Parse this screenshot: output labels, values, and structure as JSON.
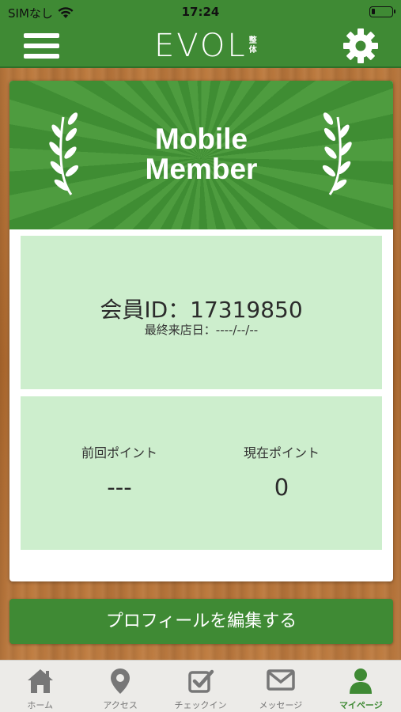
{
  "status_bar": {
    "carrier": "SIMなし",
    "time": "17:24"
  },
  "nav": {
    "logo_text": "EVOL",
    "logo_sub_1": "整",
    "logo_sub_2": "体",
    "menu_icon": "hamburger-menu-icon",
    "settings_icon": "gear-icon"
  },
  "card": {
    "title_line1": "Mobile",
    "title_line2": "Member",
    "member_id": "会員ID：17319850",
    "last_visit": "最終来店日：----/--/--",
    "previous_points_label": "前回ポイント",
    "previous_points_value": "---",
    "current_points_label": "現在ポイント",
    "current_points_value": "0"
  },
  "edit_profile_label": "プロフィールを編集する",
  "tabs": [
    {
      "label": "ホーム",
      "icon": "home-icon"
    },
    {
      "label": "アクセス",
      "icon": "map-pin-icon"
    },
    {
      "label": "チェックイン",
      "icon": "checkbox-icon"
    },
    {
      "label": "メッセージ",
      "icon": "envelope-icon"
    },
    {
      "label": "マイページ",
      "icon": "person-icon"
    }
  ],
  "colors": {
    "brand_green": "#3f8a34",
    "panel_green": "#cdeecd",
    "wood": "#b8753a"
  }
}
